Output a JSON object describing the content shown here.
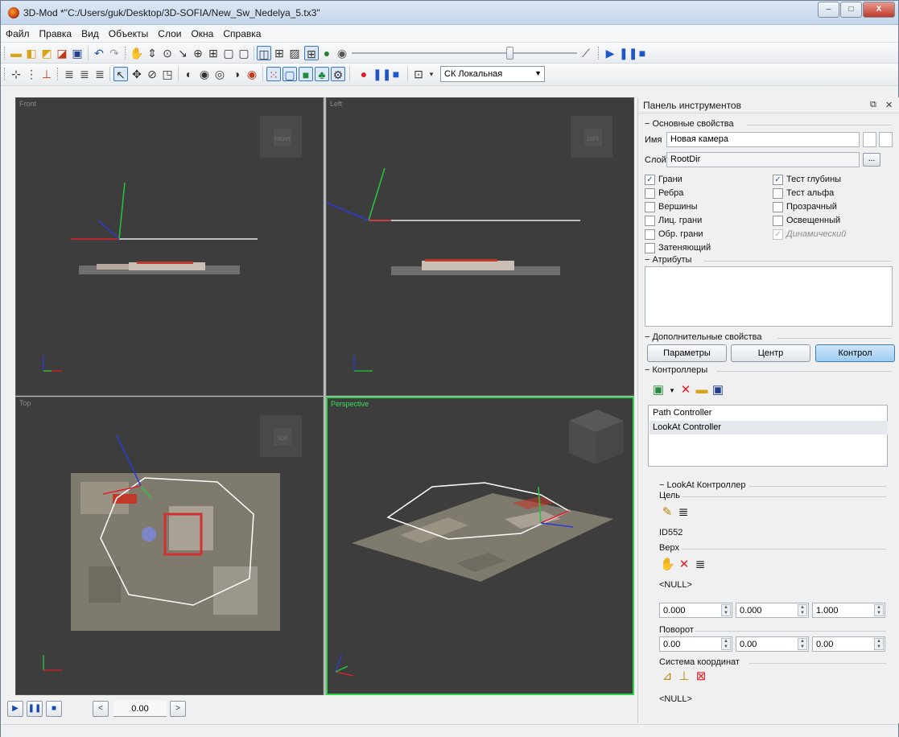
{
  "window": {
    "title": "3D-Mod *\"C:/Users/guk/Desktop/3D-SOFIA/New_Sw_Nedelya_5.tx3\"",
    "controls": {
      "minimize": "–",
      "maximize": "□",
      "close": "X"
    }
  },
  "menu": [
    "Файл",
    "Правка",
    "Вид",
    "Объекты",
    "Слои",
    "Окна",
    "Справка"
  ],
  "toolbar2": {
    "coord_system": "СК Локальная"
  },
  "viewports": {
    "front": {
      "label": "Front",
      "cube_label": "FRONT"
    },
    "left": {
      "label": "Left",
      "cube_label": "LEFT"
    },
    "top": {
      "label": "Top",
      "cube_label": "TOP"
    },
    "perspective": {
      "label": "Perspective"
    }
  },
  "timeline": {
    "time": "0.00"
  },
  "panel": {
    "title": "Панель инструментов",
    "basic": {
      "header": "Основные свойства",
      "name_label": "Имя",
      "name_value": "Новая камера",
      "layer_label": "Слой",
      "layer_value": "RootDir",
      "browse": "..."
    },
    "checks_left": [
      {
        "label": "Грани",
        "checked": "✓"
      },
      {
        "label": "Ребра",
        "checked": ""
      },
      {
        "label": "Вершины",
        "checked": ""
      },
      {
        "label": "Лиц. грани",
        "checked": ""
      },
      {
        "label": "Обр. грани",
        "checked": ""
      },
      {
        "label": "Затеняющий",
        "checked": ""
      }
    ],
    "checks_right": [
      {
        "label": "Тест глубины",
        "checked": "✓"
      },
      {
        "label": "Тест альфа",
        "checked": ""
      },
      {
        "label": "Прозрачный",
        "checked": ""
      },
      {
        "label": "Освещенный",
        "checked": ""
      },
      {
        "label": "Динамический",
        "checked": "✓"
      }
    ],
    "attributes_header": "Атрибуты",
    "extra_header": "Дополнительные свойства",
    "extra_buttons": [
      "Параметры",
      "Центр",
      "Контрол"
    ],
    "controllers_header": "Контроллеры",
    "controllers": [
      "Path Controller",
      "LookAt Controller"
    ],
    "lookat": {
      "header": "LookAt Контроллер",
      "target_label": "Цель",
      "target_value": "ID552",
      "up_label": "Верх",
      "up_value": "<NULL>",
      "up_vec": [
        "0.000",
        "0.000",
        "1.000"
      ],
      "rotation_label": "Поворот",
      "rotation_vec": [
        "0.00",
        "0.00",
        "0.00"
      ],
      "coord_label": "Система координат",
      "coord_value": "<NULL>"
    }
  }
}
